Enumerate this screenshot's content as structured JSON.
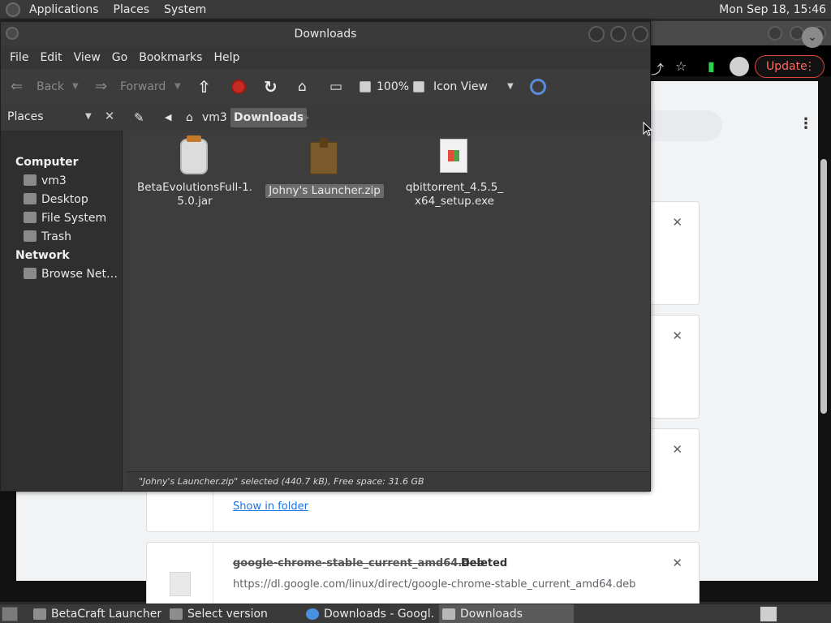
{
  "top_panel": {
    "menus": [
      "Applications",
      "Places",
      "System"
    ],
    "clock": "Mon Sep 18, 15:46"
  },
  "chrome": {
    "update_label": "Update",
    "downloads": [
      {
        "link": "Show in folder"
      },
      {
        "name": "google-chrome-stable_current_amd64.deb",
        "status": "Deleted",
        "url": "https://dl.google.com/linux/direct/google-chrome-stable_current_amd64.deb"
      }
    ]
  },
  "file_manager": {
    "title": "Downloads",
    "menu": [
      "File",
      "Edit",
      "View",
      "Go",
      "Bookmarks",
      "Help"
    ],
    "toolbar": {
      "back": "Back",
      "forward": "Forward",
      "zoom": "100%",
      "view_mode": "Icon View"
    },
    "sidebar": {
      "selector": "Places",
      "sections": [
        {
          "header": "Computer",
          "items": [
            "vm3",
            "Desktop",
            "File System",
            "Trash"
          ]
        },
        {
          "header": "Network",
          "items": [
            "Browse Net…"
          ]
        }
      ]
    },
    "path": [
      "vm3",
      "Downloads"
    ],
    "files": [
      {
        "name": "BetaEvolutionsFull-1.5.0.jar",
        "label_line1": "BetaEvolutionsFull-1.",
        "label_line2": "5.0.jar",
        "icon": "jar-icon",
        "selected": false
      },
      {
        "name": "Johny's Launcher.zip",
        "label_line1": "Johny's Launcher.zip",
        "label_line2": "",
        "icon": "zip-archive-icon",
        "selected": true
      },
      {
        "name": "qbittorrent_4.5.5_x64_setup.exe",
        "label_line1": "qbittorrent_4.5.5_",
        "label_line2": "x64_setup.exe",
        "icon": "exe-icon",
        "selected": false
      }
    ],
    "status": "\"Johny's Launcher.zip\" selected (440.7 kB), Free space: 31.6 GB"
  },
  "taskbar": {
    "tasks": [
      "BetaCraft Launcher ...",
      "Select version",
      "Downloads - Googl...",
      "Downloads"
    ]
  },
  "colors": {
    "update_red": "#e0463c",
    "stop_red": "#c62b22",
    "link_blue": "#1a73e8"
  }
}
